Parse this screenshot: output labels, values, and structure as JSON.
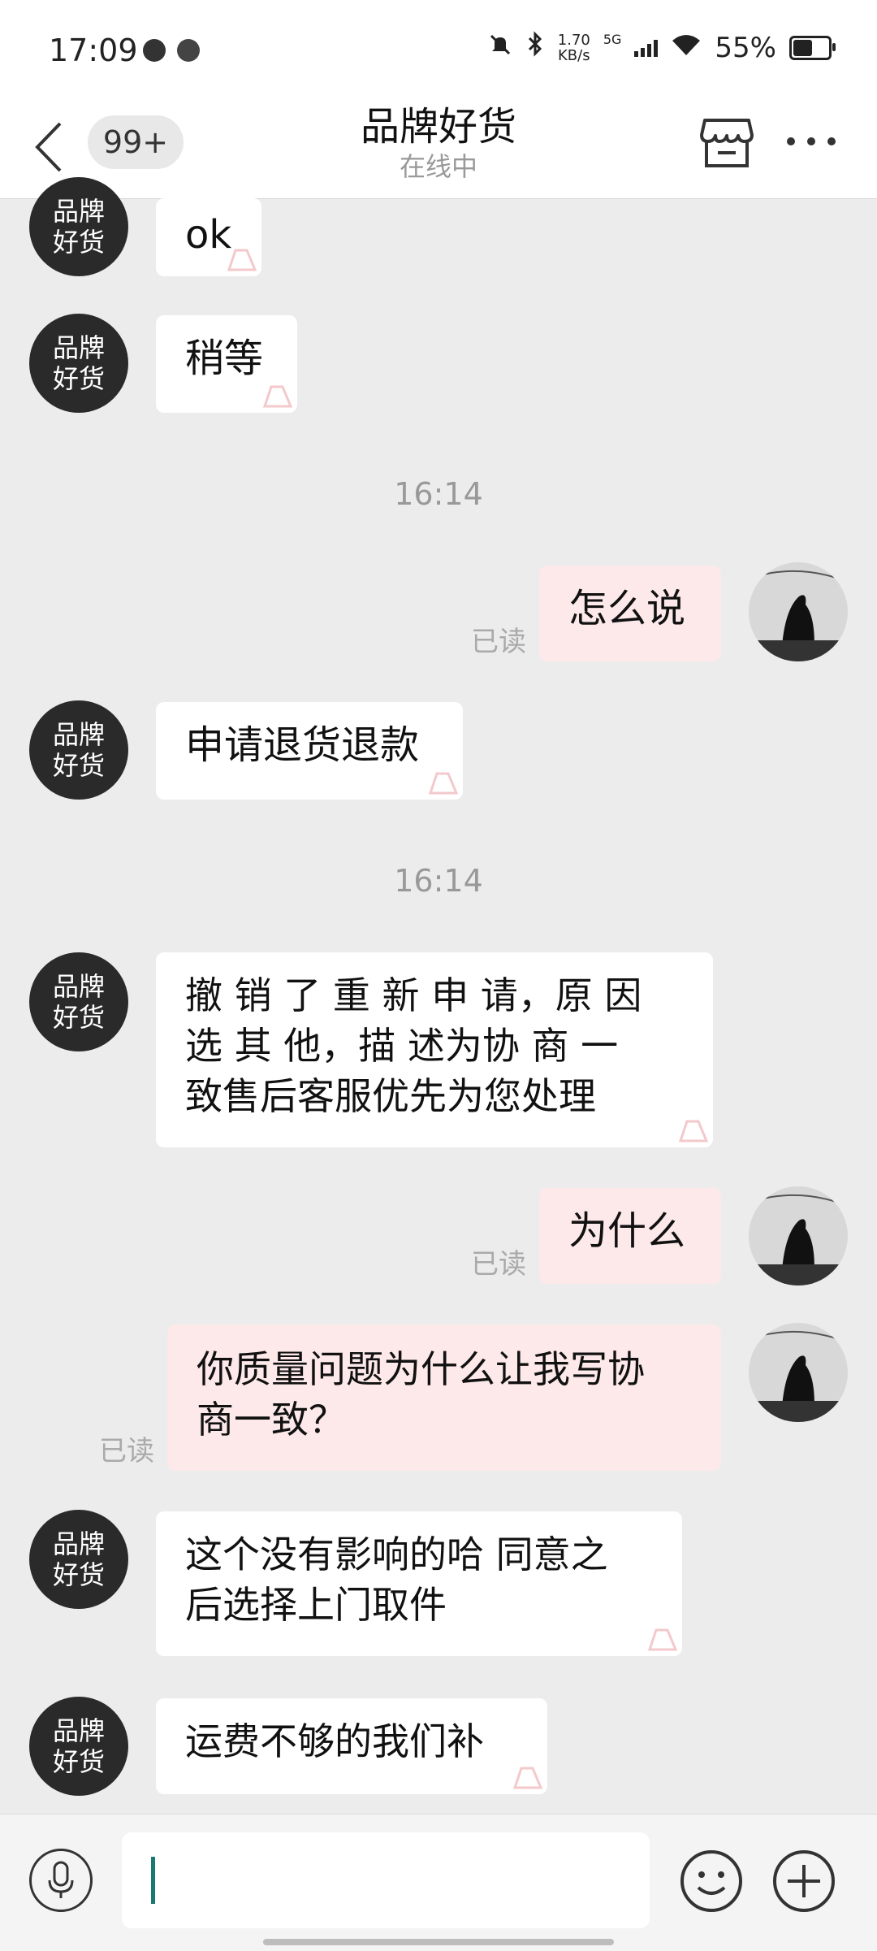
{
  "status_bar": {
    "time": "17:09",
    "net_speed_value": "1.70",
    "net_speed_unit": "KB/s",
    "network": "5G",
    "battery": "55%",
    "battery_level": 0.55
  },
  "header": {
    "back_icon": "chevron-left-icon",
    "unread_count": "99+",
    "title": "品牌好货",
    "subtitle": "在线中",
    "store_icon": "store-icon",
    "more_icon": "more-dots-icon"
  },
  "shop_avatar_text": {
    "line1": "品牌",
    "line2": "好货"
  },
  "messages": [
    {
      "from": "shop",
      "text": "ok"
    },
    {
      "from": "shop",
      "text": "稍等"
    },
    {
      "type": "timestamp",
      "text": "16:14"
    },
    {
      "from": "me",
      "text": "怎么说",
      "status": "已读"
    },
    {
      "from": "shop",
      "text": "申请退货退款"
    },
    {
      "type": "timestamp",
      "text": "16:14"
    },
    {
      "from": "shop",
      "lines": [
        "撤 销 了 重 新 申 请，原 因",
        "选 其 他，描 述为协 商 一",
        "致售后客服优先为您处理"
      ]
    },
    {
      "from": "me",
      "text": "为什么",
      "status": "已读"
    },
    {
      "from": "me",
      "lines": [
        "你质量问题为什么让我写协",
        "商一致？"
      ],
      "status": "已读"
    },
    {
      "from": "shop",
      "lines": [
        "这个没有影响的哈 同意之",
        "后选择上门取件"
      ]
    },
    {
      "from": "shop",
      "text": "运费不够的我们补"
    }
  ],
  "input": {
    "value": "",
    "mic_icon": "microphone-icon",
    "emoji_icon": "emoji-icon",
    "plus_icon": "plus-icon"
  }
}
